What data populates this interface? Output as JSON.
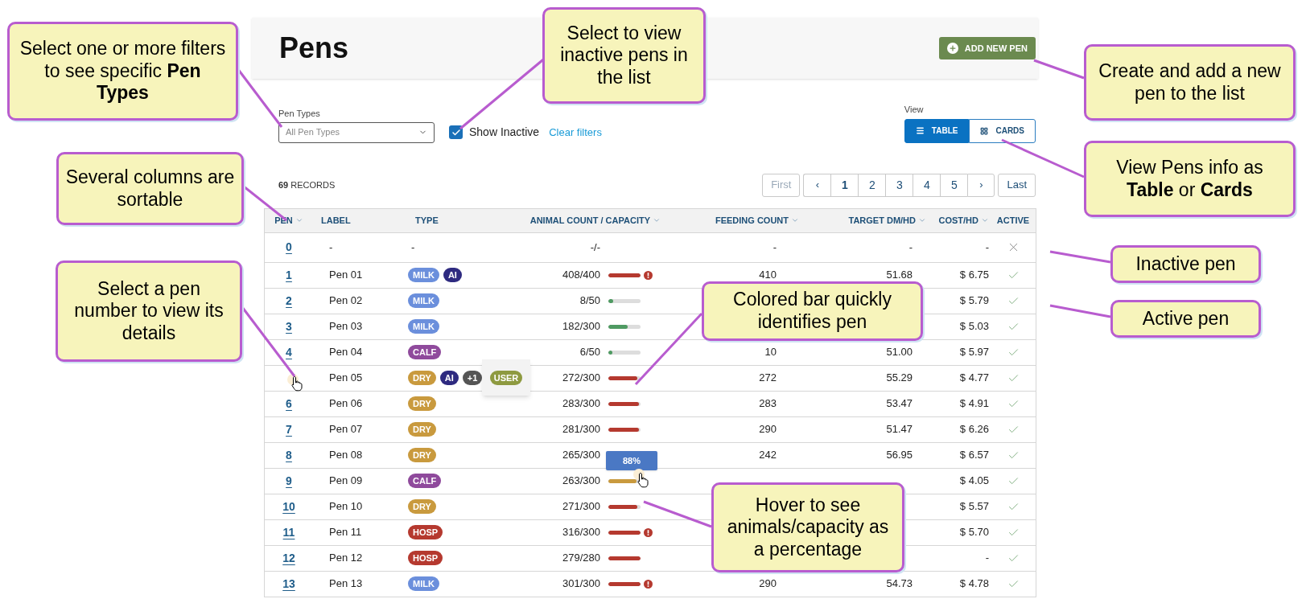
{
  "page": {
    "title": "Pens",
    "add_button": "ADD NEW PEN"
  },
  "filters": {
    "pen_types": {
      "label": "Pen Types",
      "placeholder": "All Pen Types"
    },
    "show_inactive": {
      "label": "Show Inactive",
      "checked": true
    },
    "clear": "Clear filters",
    "view": {
      "label": "View",
      "options": [
        {
          "label": "TABLE",
          "kind": "list",
          "selected": true
        },
        {
          "label": "CARDS",
          "kind": "grid",
          "selected": false
        }
      ]
    }
  },
  "records": {
    "count": "69",
    "label": "RECORDS"
  },
  "pagination": [
    {
      "label": "First",
      "kind": "text",
      "disabled": true,
      "selected": false
    },
    {
      "label": "‹",
      "kind": "arrow",
      "disabled": false,
      "selected": false
    },
    {
      "label": "1",
      "kind": "page",
      "disabled": false,
      "selected": true
    },
    {
      "label": "2",
      "kind": "page",
      "disabled": false,
      "selected": false
    },
    {
      "label": "3",
      "kind": "page",
      "disabled": false,
      "selected": false
    },
    {
      "label": "4",
      "kind": "page",
      "disabled": false,
      "selected": false
    },
    {
      "label": "5",
      "kind": "page",
      "disabled": false,
      "selected": false
    },
    {
      "label": "›",
      "kind": "arrow",
      "disabled": false,
      "selected": false
    },
    {
      "label": "Last",
      "kind": "text",
      "disabled": false,
      "selected": false
    }
  ],
  "table": {
    "columns": [
      {
        "label": "PEN",
        "sortable": true
      },
      {
        "label": "LABEL",
        "sortable": false
      },
      {
        "label": "TYPE",
        "sortable": false
      },
      {
        "label": "ANIMAL COUNT / CAPACITY",
        "sortable": true
      },
      {
        "label": "FEEDING COUNT",
        "sortable": true
      },
      {
        "label": "TARGET DM/HD",
        "sortable": true
      },
      {
        "label": "COST/HD",
        "sortable": true
      },
      {
        "label": "ACTIVE",
        "sortable": false
      }
    ],
    "rows": [
      {
        "pen": "0",
        "label": "-",
        "type_text": "-",
        "count": "-/-",
        "feeding": "-",
        "target": "-",
        "cost": "-",
        "active": false
      },
      {
        "pen": "1",
        "label": "Pen 01",
        "tags": [
          {
            "text": "MILK",
            "color": "#6b8fdc"
          },
          {
            "text": "AI",
            "color": "#2e2a80"
          }
        ],
        "count": "408/400",
        "level": 1,
        "color": "#b5392f",
        "alert": true,
        "feeding": "410",
        "target": "51.68",
        "cost": "$ 6.75",
        "active": true
      },
      {
        "pen": "2",
        "label": "Pen 02",
        "tags": [
          {
            "text": "MILK",
            "color": "#6b8fdc"
          }
        ],
        "count": "8/50",
        "level": 0.16,
        "color": "#4f9a62",
        "alert": false,
        "cost": "$ 5.79",
        "active": true
      },
      {
        "pen": "3",
        "label": "Pen 03",
        "tags": [
          {
            "text": "MILK",
            "color": "#6b8fdc"
          }
        ],
        "count": "182/300",
        "level": 0.61,
        "color": "#4f9a62",
        "alert": false,
        "cost": "$ 5.03",
        "active": true
      },
      {
        "pen": "4",
        "label": "Pen 04",
        "tags": [
          {
            "text": "CALF",
            "color": "#8f4a9c"
          }
        ],
        "count": "6/50",
        "level": 0.12,
        "color": "#4f9a62",
        "alert": false,
        "feeding": "10",
        "target": "51.00",
        "cost": "$ 5.97",
        "active": true
      },
      {
        "label": "Pen 05",
        "tags": [
          {
            "text": "DRY",
            "color": "#c99a3e"
          },
          {
            "text": "AI",
            "color": "#2e2a80"
          },
          {
            "text": "+1",
            "color": "#555555"
          }
        ],
        "popover": {
          "text": "USER",
          "color": "#8e9a40"
        },
        "cursor": true,
        "count": "272/300",
        "level": 0.91,
        "color": "#b5392f",
        "alert": false,
        "feeding": "272",
        "target": "55.29",
        "cost": "$ 4.77",
        "active": true
      },
      {
        "pen": "6",
        "label": "Pen 06",
        "tags": [
          {
            "text": "DRY",
            "color": "#c99a3e"
          }
        ],
        "count": "283/300",
        "level": 0.94,
        "color": "#b5392f",
        "alert": false,
        "feeding": "283",
        "target": "53.47",
        "cost": "$ 4.91",
        "active": true
      },
      {
        "pen": "7",
        "label": "Pen 07",
        "tags": [
          {
            "text": "DRY",
            "color": "#c99a3e"
          }
        ],
        "count": "281/300",
        "level": 0.94,
        "color": "#b5392f",
        "alert": false,
        "feeding": "290",
        "target": "51.47",
        "cost": "$ 6.26",
        "active": true
      },
      {
        "pen": "8",
        "label": "Pen 08",
        "tags": [
          {
            "text": "DRY",
            "color": "#c99a3e"
          }
        ],
        "count": "265/300",
        "feeding": "242",
        "target": "56.95",
        "cost": "$ 6.57",
        "active": true
      },
      {
        "pen": "9",
        "label": "Pen 09",
        "tags": [
          {
            "text": "CALF",
            "color": "#8f4a9c"
          }
        ],
        "count": "263/300",
        "level": 0.88,
        "color": "#c99a3e",
        "alert": false,
        "tooltip": "88%",
        "cursor_bar": true,
        "cost": "$ 4.05",
        "active": true
      },
      {
        "pen": "10",
        "label": "Pen 10",
        "tags": [
          {
            "text": "DRY",
            "color": "#c99a3e"
          }
        ],
        "count": "271/300",
        "level": 0.9,
        "color": "#b5392f",
        "alert": false,
        "cost": "$ 5.57",
        "active": true
      },
      {
        "pen": "11",
        "label": "Pen 11",
        "tags": [
          {
            "text": "HOSP",
            "color": "#b5392f"
          }
        ],
        "count": "316/300",
        "level": 1,
        "color": "#b5392f",
        "alert": true,
        "cost": "$ 5.70",
        "active": true
      },
      {
        "pen": "12",
        "label": "Pen 12",
        "tags": [
          {
            "text": "HOSP",
            "color": "#b5392f"
          }
        ],
        "count": "279/280",
        "level": 1,
        "color": "#b5392f",
        "alert": false,
        "cost": "-",
        "active": true
      },
      {
        "pen": "13",
        "label": "Pen 13",
        "tags": [
          {
            "text": "MILK",
            "color": "#6b8fdc"
          }
        ],
        "count": "301/300",
        "level": 1,
        "color": "#b5392f",
        "alert": true,
        "feeding": "290",
        "target": "54.73",
        "cost": "$ 4.78",
        "active": true
      }
    ]
  },
  "callouts": [
    {
      "text": "Select one or more filters to see specific **Pen Types**"
    },
    {
      "text": "Select to view inactive pens in the list"
    },
    {
      "text": "Several columns are sortable"
    },
    {
      "text": "Select a pen number to view its details"
    },
    {
      "text": "Create and add a new pen to the list"
    },
    {
      "text": "View Pens info as **Table** or **Cards**"
    },
    {
      "text": "Inactive pen"
    },
    {
      "text": "Active pen"
    },
    {
      "text": "Colored bar quickly identifies pen"
    },
    {
      "text": "Hover to see animals/capacity as a percentage"
    }
  ]
}
